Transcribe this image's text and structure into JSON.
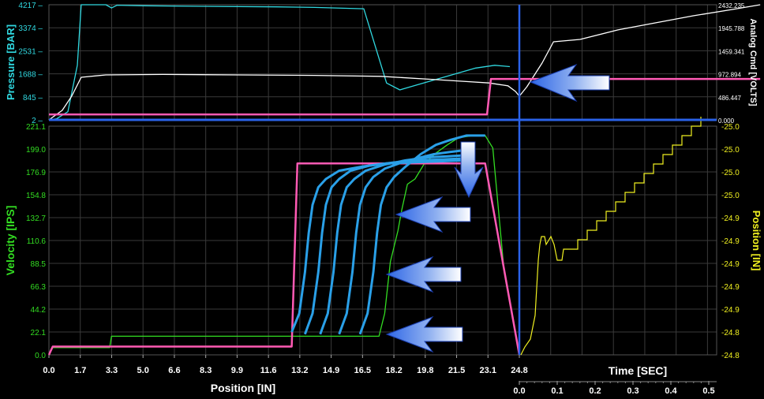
{
  "colors": {
    "background": "#000000",
    "grid": "#3a3a3a",
    "pressure": "#30d8e0",
    "analog": "#ffffff",
    "command": "#ff5ab4",
    "velocity": "#33dd22",
    "overlay": "#2aa0e8",
    "position": "#f0f020",
    "cursor": "#2a62e8",
    "arrow": "#3a6ee8",
    "pressure_axis_text": "#30d8e0",
    "velocity_axis_text": "#33dd22",
    "position_axis_text": "#f0f020",
    "white_text": "#ffffff"
  },
  "chart_data": [
    {
      "type": "line",
      "panel": "top",
      "ylabel": "Pressure [BAR]",
      "y_ticks": [
        "4217",
        "3374",
        "2531",
        "1688",
        "845",
        "2"
      ],
      "ylim": [
        2,
        4217
      ],
      "y2label": "Analog Cmd [VOLTS]",
      "y2_ticks": [
        "2432.235",
        "1945.788",
        "1459.341",
        "972.894",
        "486.447",
        "0.000"
      ],
      "y2lim": [
        0,
        2432.235
      ],
      "grid": true,
      "series": [
        {
          "key": "pressure",
          "axis": "left",
          "x": [
            0,
            0.4,
            1,
            1.5,
            1.7,
            3,
            3.3,
            3.6,
            5,
            8,
            12,
            14,
            16.6,
            17.8,
            18.5,
            19.5,
            21,
            22.5,
            23.5,
            24.3
          ],
          "y": [
            2,
            40,
            300,
            2000,
            4217,
            4217,
            4100,
            4200,
            4180,
            4160,
            4140,
            4120,
            4070,
            1350,
            1100,
            1300,
            1600,
            1900,
            2000,
            1950
          ]
        },
        {
          "key": "analog",
          "axis": "right",
          "x": [
            0,
            0.7,
            1.2,
            1.7,
            3,
            6,
            10,
            14,
            17.5,
            20,
            22,
            23.2,
            24.2,
            24.6,
            24.8,
            25.2,
            26,
            26.6,
            28,
            30,
            32,
            34,
            36,
            37.5
          ],
          "y": [
            0,
            200,
            500,
            900,
            950,
            960,
            950,
            940,
            920,
            860,
            810,
            780,
            720,
            600,
            500,
            700,
            1200,
            1650,
            1700,
            1900,
            2050,
            2200,
            2330,
            2432
          ]
        },
        {
          "key": "command",
          "axis": "left",
          "x": [
            0,
            23.1,
            23.3,
            37.5
          ],
          "y": [
            200,
            200,
            1500,
            1500
          ]
        }
      ]
    },
    {
      "type": "line",
      "panel": "bottom",
      "xlabel": "Position [IN]",
      "x_ticks": [
        "0.0",
        "1.7",
        "3.3",
        "5.0",
        "6.6",
        "8.3",
        "9.9",
        "11.6",
        "13.2",
        "14.9",
        "16.5",
        "18.2",
        "19.8",
        "21.5",
        "23.1",
        "24.8"
      ],
      "xlim": [
        0,
        24.8
      ],
      "ylabel": "Velocity [IPS]",
      "y_ticks": [
        "221.1",
        "199.0",
        "176.9",
        "154.8",
        "132.7",
        "110.6",
        "88.5",
        "66.3",
        "44.2",
        "22.1",
        "0.0"
      ],
      "ylim": [
        0,
        221.1
      ],
      "y2label": "Position [IN]",
      "y2_ticks": [
        "-25.0",
        "-25.0",
        "-25.0",
        "-25.0",
        "-24.9",
        "-24.9",
        "-24.9",
        "-24.9",
        "-24.9",
        "-24.8",
        "-24.8"
      ],
      "time_label": "Time [SEC]",
      "time_ticks": [
        "0.0",
        "0.1",
        "0.2",
        "0.3",
        "0.4",
        "0.5"
      ],
      "grid": true,
      "series": [
        {
          "key": "velocity",
          "x": [
            0,
            0.2,
            3.2,
            3.3,
            5,
            10,
            13.2,
            16.5,
            17.4,
            17.7,
            18.0,
            18.4,
            18.6,
            18.9,
            19.3,
            19.8,
            20.4,
            21.0,
            21.6,
            22.4,
            23.0,
            23.4,
            23.7,
            24.0,
            24.5,
            24.8
          ],
          "y": [
            0,
            7,
            7,
            18,
            18,
            18,
            18,
            18,
            18,
            40,
            90,
            120,
            140,
            165,
            170,
            185,
            195,
            203,
            210,
            212,
            212,
            200,
            140,
            80,
            30,
            0
          ]
        },
        {
          "key": "command",
          "x": [
            0,
            0.2,
            3.3,
            12.8,
            13.1,
            23.0,
            24.8
          ],
          "y": [
            0,
            8,
            8,
            8,
            185,
            185,
            0
          ]
        },
        {
          "key": "overlay",
          "x": [
            12.8,
            13.2,
            13.5,
            13.7,
            13.9,
            14.2,
            14.6,
            15.3,
            16.5,
            17.8,
            19.0,
            20.5,
            22.0
          ],
          "y": [
            22,
            40,
            80,
            118,
            145,
            162,
            170,
            178,
            182,
            185,
            186,
            187,
            188
          ]
        },
        {
          "key": "overlay",
          "x": [
            13.5,
            13.9,
            14.2,
            14.4,
            14.6,
            14.9,
            15.3,
            15.9,
            16.9,
            18.2,
            19.5,
            20.8,
            22.0
          ],
          "y": [
            20,
            40,
            80,
            118,
            145,
            162,
            170,
            178,
            183,
            186,
            188,
            189,
            190
          ]
        },
        {
          "key": "overlay",
          "x": [
            14.3,
            14.7,
            15.0,
            15.2,
            15.4,
            15.7,
            16.1,
            16.7,
            17.7,
            18.8,
            20.0,
            21.0,
            22.0
          ],
          "y": [
            20,
            40,
            80,
            118,
            145,
            162,
            170,
            178,
            184,
            188,
            191,
            192,
            193
          ]
        },
        {
          "key": "overlay",
          "x": [
            15.3,
            15.7,
            16.0,
            16.2,
            16.4,
            16.7,
            17.1,
            17.7,
            18.6,
            19.4,
            20.3,
            21.1,
            22.0
          ],
          "y": [
            20,
            40,
            80,
            118,
            145,
            162,
            172,
            180,
            186,
            190,
            194,
            196,
            198
          ]
        },
        {
          "key": "overlay",
          "x": [
            16.4,
            16.8,
            17.1,
            17.3,
            17.5,
            17.8,
            18.2,
            18.8,
            19.6,
            20.4,
            21.2,
            22.0,
            23.0
          ],
          "y": [
            20,
            40,
            80,
            118,
            145,
            162,
            172,
            182,
            194,
            203,
            208,
            212,
            212
          ]
        }
      ]
    }
  ]
}
